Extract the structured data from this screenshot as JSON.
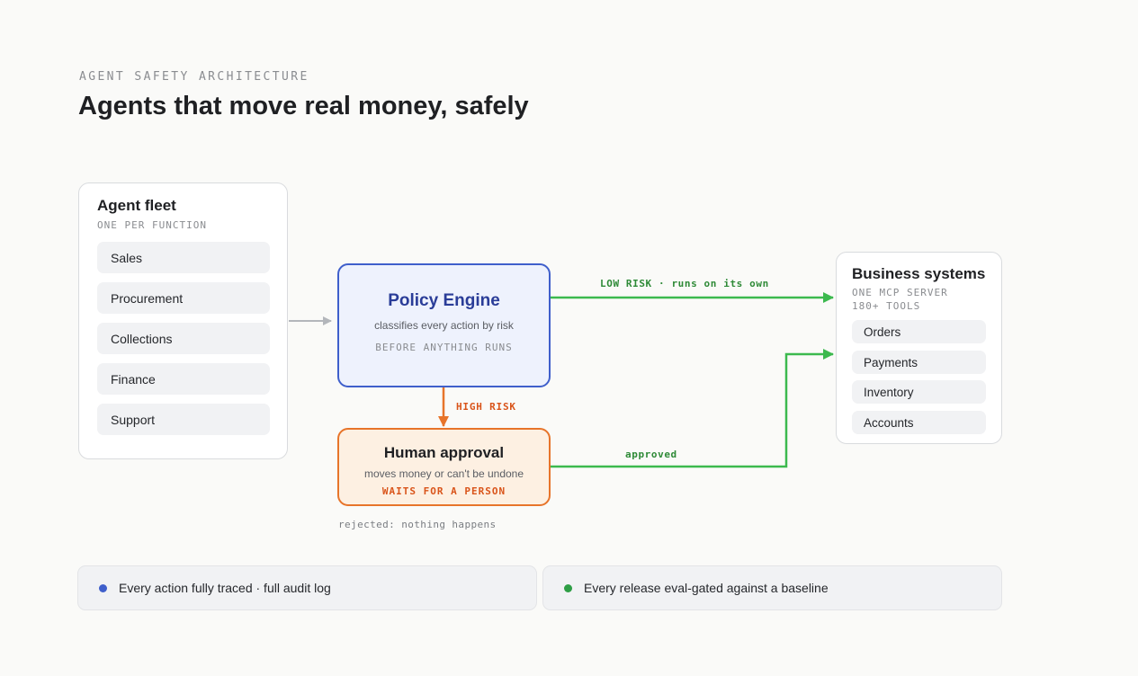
{
  "header": {
    "eyebrow": "AGENT SAFETY ARCHITECTURE",
    "title": "Agents that move real money, safely"
  },
  "fleet": {
    "title": "Agent fleet",
    "subtitle": "ONE PER FUNCTION",
    "items": [
      {
        "label": "Sales"
      },
      {
        "label": "Procurement"
      },
      {
        "label": "Collections"
      },
      {
        "label": "Finance"
      },
      {
        "label": "Support"
      }
    ]
  },
  "policy": {
    "title": "Policy Engine",
    "description": "classifies every action by risk",
    "note": "BEFORE ANYTHING RUNS"
  },
  "human": {
    "title": "Human approval",
    "description": "moves money or can't be undone",
    "note": "WAITS FOR A PERSON",
    "rejected": "rejected: nothing happens"
  },
  "business": {
    "title": "Business systems",
    "subtitle_1": "ONE MCP SERVER",
    "subtitle_2": "180+ TOOLS",
    "items": [
      {
        "label": "Orders"
      },
      {
        "label": "Payments"
      },
      {
        "label": "Inventory"
      },
      {
        "label": "Accounts"
      }
    ]
  },
  "edges": {
    "low_risk": "LOW RISK · runs on its own",
    "high_risk": "HIGH RISK",
    "approved": "approved"
  },
  "footer": {
    "left": "Every action fully traced · full audit log",
    "right": "Every release eval-gated against a baseline"
  },
  "colors": {
    "policy_accent": "#3f5fcb",
    "approval_accent": "#e7742a",
    "approved_green": "#3cb94e",
    "neutral_arrow": "#b3b6bb"
  }
}
